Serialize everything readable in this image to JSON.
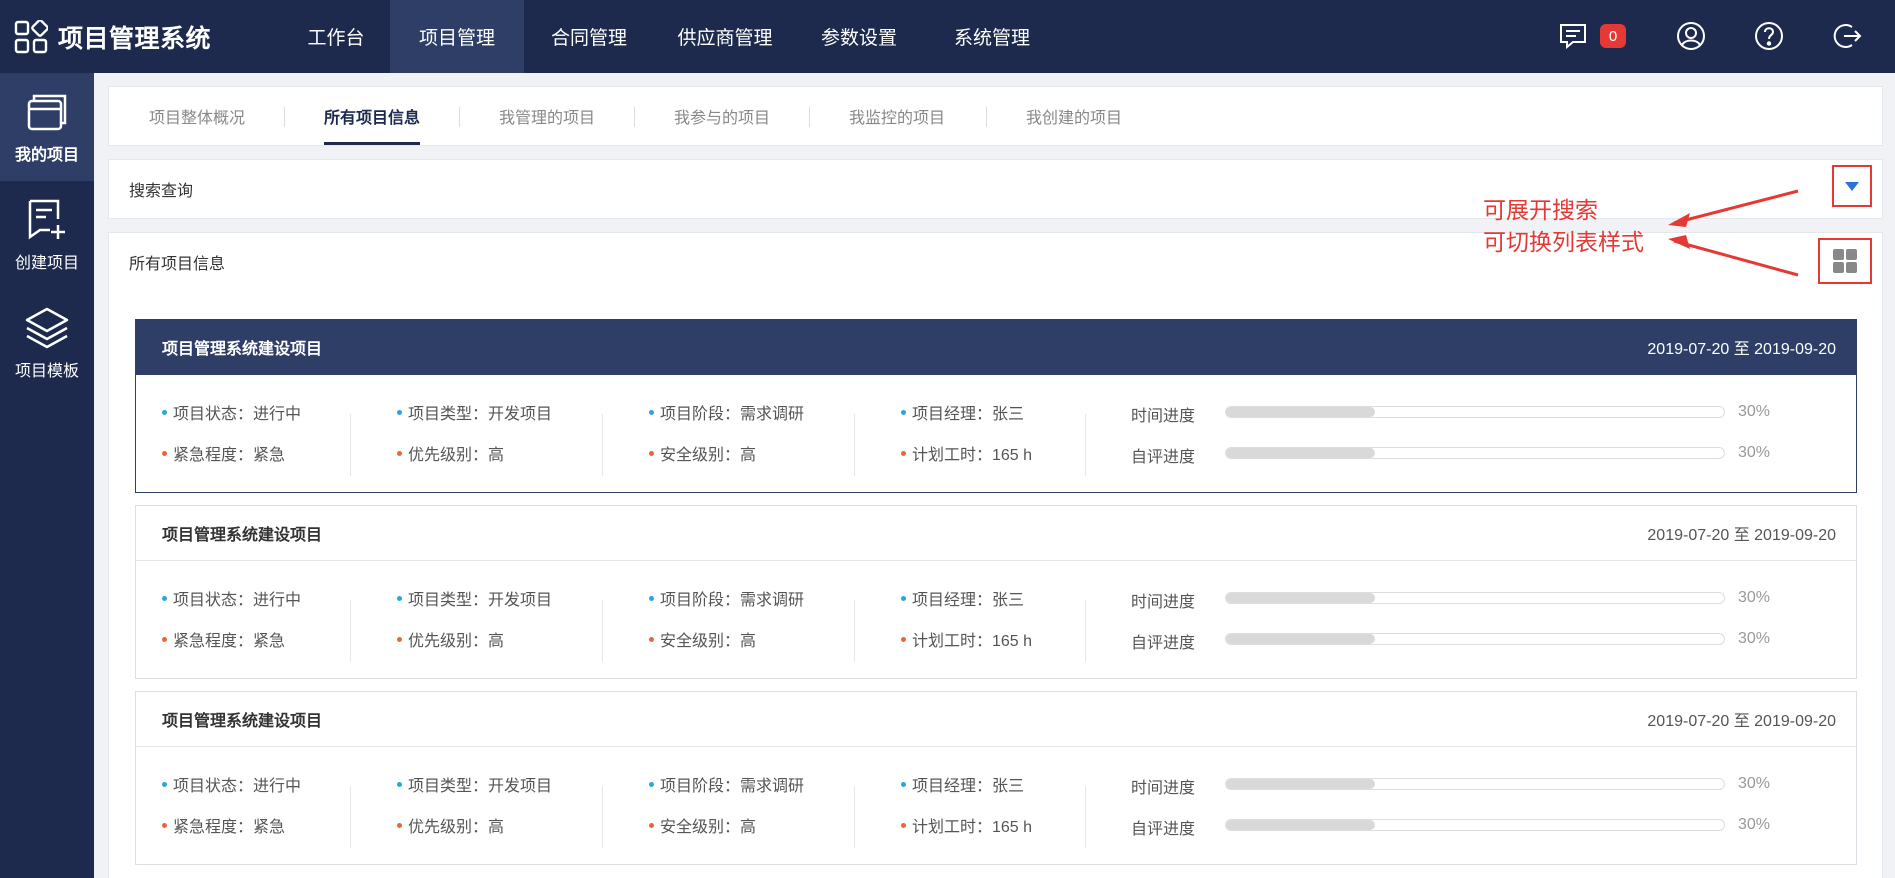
{
  "app": {
    "title": "项目管理系统"
  },
  "nav": [
    {
      "label": "工作台"
    },
    {
      "label": "项目管理"
    },
    {
      "label": "合同管理"
    },
    {
      "label": "供应商管理"
    },
    {
      "label": "参数设置"
    },
    {
      "label": "系统管理"
    }
  ],
  "header": {
    "message_count": "0"
  },
  "sidebar": [
    {
      "label": "我的项目",
      "icon": "folder-icon"
    },
    {
      "label": "创建项目",
      "icon": "add-document-icon"
    },
    {
      "label": "项目模板",
      "icon": "layers-icon"
    }
  ],
  "tabs": [
    {
      "label": "项目整体概况"
    },
    {
      "label": "所有项目信息"
    },
    {
      "label": "我管理的项目"
    },
    {
      "label": "我参与的项目"
    },
    {
      "label": "我监控的项目"
    },
    {
      "label": "我创建的项目"
    }
  ],
  "search": {
    "title": "搜索查询"
  },
  "list": {
    "title": "所有项目信息"
  },
  "annotation": {
    "line1": "可展开搜索",
    "line2": "可切换列表样式"
  },
  "colors": {
    "primary": "#1d2a4d",
    "active": "#2e3e66",
    "accent_red": "#e53935",
    "dot_blue": "#2aa7d8",
    "dot_orange": "#e8673a"
  },
  "projects": [
    {
      "title": "项目管理系统建设项目",
      "date_range": "2019-07-20 至 2019-09-20",
      "status": "项目状态：进行中",
      "type": "项目类型：开发项目",
      "phase": "项目阶段：需求调研",
      "manager": "项目经理：张三",
      "urgency": "紧急程度：紧急",
      "priority": "优先级别：高",
      "security": "安全级别：高",
      "planned_hours": "计划工时：165 h",
      "time_progress_label": "时间进度",
      "time_progress_text": "30%",
      "time_progress": 0.3,
      "self_progress_label": "自评进度",
      "self_progress_text": "30%",
      "self_progress": 0.3
    },
    {
      "title": "项目管理系统建设项目",
      "date_range": "2019-07-20 至 2019-09-20",
      "status": "项目状态：进行中",
      "type": "项目类型：开发项目",
      "phase": "项目阶段：需求调研",
      "manager": "项目经理：张三",
      "urgency": "紧急程度：紧急",
      "priority": "优先级别：高",
      "security": "安全级别：高",
      "planned_hours": "计划工时：165 h",
      "time_progress_label": "时间进度",
      "time_progress_text": "30%",
      "time_progress": 0.3,
      "self_progress_label": "自评进度",
      "self_progress_text": "30%",
      "self_progress": 0.3
    },
    {
      "title": "项目管理系统建设项目",
      "date_range": "2019-07-20 至 2019-09-20",
      "status": "项目状态：进行中",
      "type": "项目类型：开发项目",
      "phase": "项目阶段：需求调研",
      "manager": "项目经理：张三",
      "urgency": "紧急程度：紧急",
      "priority": "优先级别：高",
      "security": "安全级别：高",
      "planned_hours": "计划工时：165 h",
      "time_progress_label": "时间进度",
      "time_progress_text": "30%",
      "time_progress": 0.3,
      "self_progress_label": "自评进度",
      "self_progress_text": "30%",
      "self_progress": 0.3
    }
  ]
}
